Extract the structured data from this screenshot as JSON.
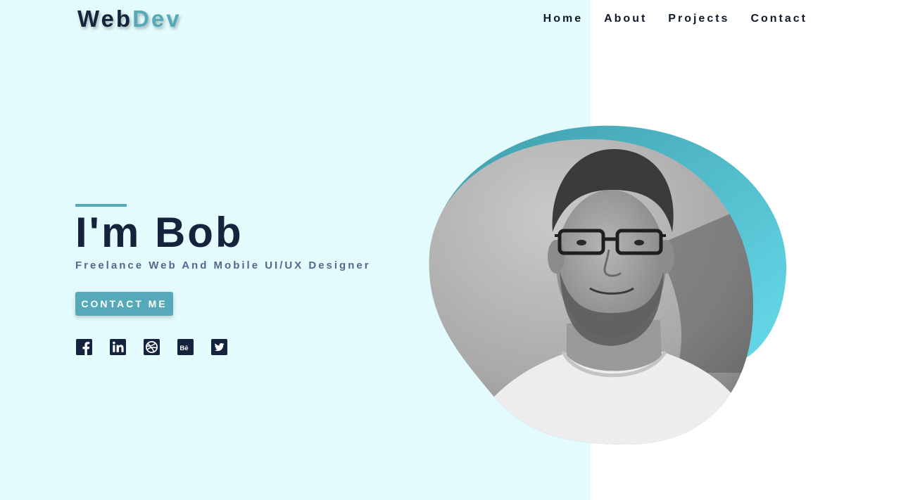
{
  "header": {
    "logo_part1": "Web",
    "logo_part2": "Dev",
    "nav": [
      "Home",
      "About",
      "Projects",
      "Contact"
    ]
  },
  "hero": {
    "title": "I'm Bob",
    "subtitle": "Freelance Web And Mobile UI/UX Designer",
    "cta_label": "CONTACT ME"
  },
  "socials": [
    "facebook-icon",
    "linkedin-icon",
    "dribbble-icon",
    "behance-icon",
    "twitter-icon"
  ],
  "colors": {
    "background_left": "#e3fbfd",
    "accent": "#55a9b8",
    "heading": "#16233d",
    "subtitle": "#4d6a8c",
    "blob_gradient": [
      "#47a7b5",
      "#63d8e8"
    ]
  },
  "portrait": {
    "icon": "person-photo",
    "style": "grayscale"
  }
}
